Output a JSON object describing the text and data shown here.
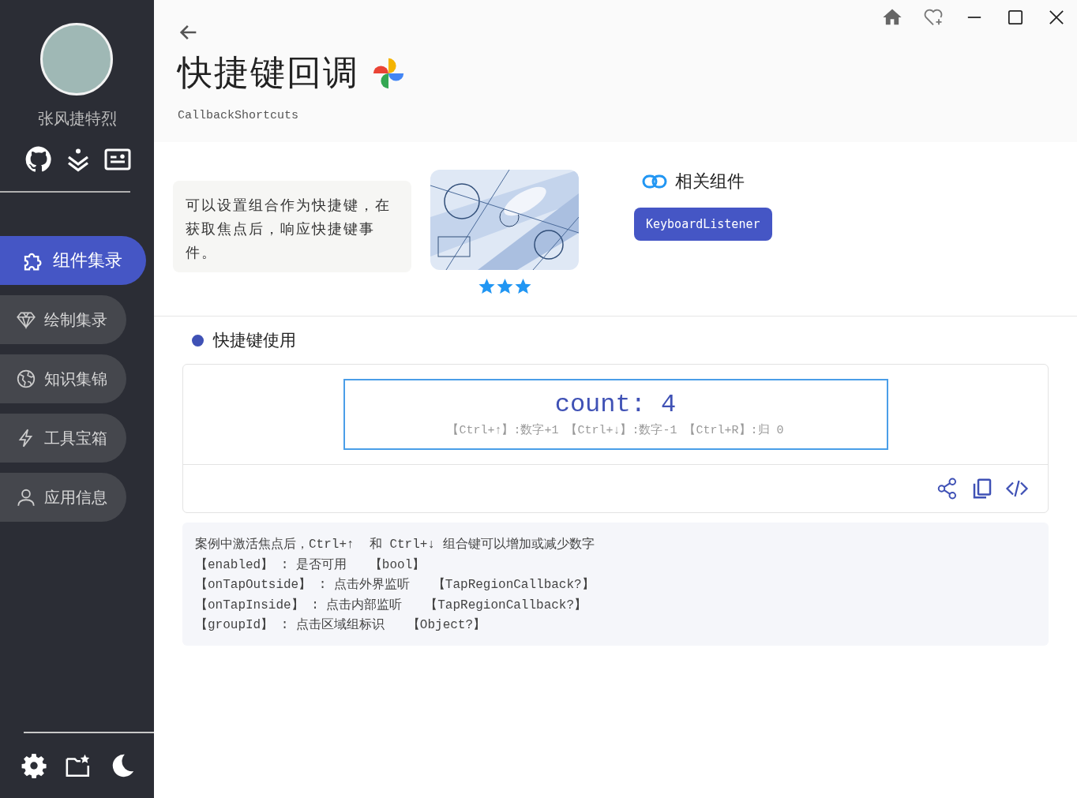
{
  "sidebar": {
    "user_name": "张风捷特烈",
    "nav": [
      {
        "label": "组件集录",
        "selected": true
      },
      {
        "label": "绘制集录",
        "selected": false
      },
      {
        "label": "知识集锦",
        "selected": false
      },
      {
        "label": "工具宝箱",
        "selected": false
      },
      {
        "label": "应用信息",
        "selected": false
      }
    ]
  },
  "page": {
    "title": "快捷键回调",
    "subtitle": "CallbackShortcuts",
    "description": "可以设置组合作为快捷键，在获取焦点后，响应快捷键事件。",
    "preview": {
      "kind": "picture",
      "stars": 3
    },
    "related": {
      "title": "相关组件",
      "items": [
        "KeyboardListener"
      ]
    }
  },
  "section": {
    "title": "快捷键使用",
    "demo": {
      "count": "count: 4",
      "hint": "【Ctrl+↑】:数字+1 【Ctrl+↓】:数字-1 【Ctrl+R】:归 0"
    },
    "notes": [
      "案例中激活焦点后，Ctrl+↑  和 Ctrl+↓ 组合键可以增加或减少数字",
      "【enabled】 : 是否可用   【bool】",
      "【onTapOutside】 : 点击外界监听   【TapRegionCallback?】",
      "【onTapInside】 : 点击内部监听   【TapRegionCallback?】",
      "【groupId】 : 点击区域组标识   【Object?】"
    ]
  }
}
